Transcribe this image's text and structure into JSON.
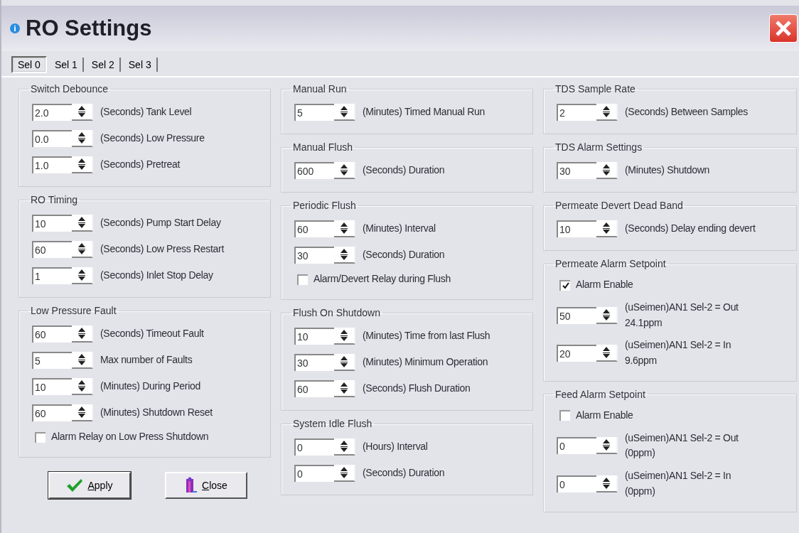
{
  "window": {
    "title": "RO Settings"
  },
  "tabs": [
    {
      "label": "Sel 0",
      "selected": true
    },
    {
      "label": "Sel 1",
      "selected": false
    },
    {
      "label": "Sel 2",
      "selected": false
    },
    {
      "label": "Sel 3",
      "selected": false
    }
  ],
  "columns": [
    {
      "groups": [
        {
          "title": "Switch Debounce",
          "items": [
            {
              "kind": "spin",
              "value": "2.0",
              "label": "(Seconds) Tank Level"
            },
            {
              "kind": "spin",
              "value": "0.0",
              "label": "(Seconds) Low Pressure"
            },
            {
              "kind": "spin",
              "value": "1.0",
              "label": "(Seconds) Pretreat"
            }
          ]
        },
        {
          "title": "RO Timing",
          "items": [
            {
              "kind": "spin",
              "value": "10",
              "label": "(Seconds) Pump Start Delay"
            },
            {
              "kind": "spin",
              "value": "60",
              "label": "(Seconds) Low Press Restart"
            },
            {
              "kind": "spin",
              "value": "1",
              "label": "(Seconds) Inlet Stop Delay"
            }
          ]
        },
        {
          "title": "Low Pressure Fault",
          "items": [
            {
              "kind": "spin",
              "value": "60",
              "label": "(Seconds) Timeout Fault"
            },
            {
              "kind": "spin",
              "value": "5",
              "label": "Max number of Faults"
            },
            {
              "kind": "spin",
              "value": "10",
              "label": "(Minutes) During Period"
            },
            {
              "kind": "spin",
              "value": "60",
              "label": "(Minutes) Shutdown Reset"
            },
            {
              "kind": "check",
              "checked": false,
              "caption": "Alarm Relay on Low Press Shutdown"
            }
          ]
        }
      ]
    },
    {
      "groups": [
        {
          "title": "Manual Run",
          "items": [
            {
              "kind": "spin",
              "value": "5",
              "label": "(Minutes) Timed Manual Run"
            }
          ]
        },
        {
          "title": "Manual Flush",
          "items": [
            {
              "kind": "spin",
              "value": "600",
              "label": "(Seconds) Duration"
            }
          ]
        },
        {
          "title": "Periodic Flush",
          "items": [
            {
              "kind": "spin",
              "value": "60",
              "label": "(Minutes) Interval"
            },
            {
              "kind": "spin",
              "value": "30",
              "label": "(Seconds) Duration"
            },
            {
              "kind": "check",
              "checked": false,
              "caption": "Alarm/Devert Relay during Flush"
            }
          ]
        },
        {
          "title": "Flush On Shutdown",
          "items": [
            {
              "kind": "spin",
              "value": "10",
              "label": "(Minutes) Time from last Flush"
            },
            {
              "kind": "spin",
              "value": "30",
              "label": "(Minutes) Minimum Operation"
            },
            {
              "kind": "spin",
              "value": "60",
              "label": "(Seconds) Flush Duration"
            }
          ]
        },
        {
          "title": "System Idle Flush",
          "items": [
            {
              "kind": "spin",
              "value": "0",
              "label": "(Hours) Interval"
            },
            {
              "kind": "spin",
              "value": "0",
              "label": "(Seconds) Duration"
            }
          ]
        }
      ]
    },
    {
      "groups": [
        {
          "title": "TDS Sample Rate",
          "items": [
            {
              "kind": "spin",
              "value": "2",
              "label": "(Seconds) Between Samples"
            }
          ]
        },
        {
          "title": "TDS Alarm Settings",
          "items": [
            {
              "kind": "spin",
              "value": "30",
              "label": "(Minutes) Shutdown"
            }
          ]
        },
        {
          "title": "Permeate Devert Dead Band",
          "items": [
            {
              "kind": "spin",
              "value": "10",
              "label": "(Seconds) Delay ending devert"
            }
          ]
        },
        {
          "title": "Permeate Alarm Setpoint",
          "items": [
            {
              "kind": "check",
              "checked": true,
              "caption": "Alarm Enable"
            },
            {
              "kind": "spin",
              "value": "50",
              "label": "(uSeimen)AN1 Sel-2 = Out\n24.1ppm"
            },
            {
              "kind": "spin",
              "value": "20",
              "label": "(uSeimen)AN1 Sel-2 = In\n9.6ppm"
            }
          ]
        },
        {
          "title": "Feed Alarm Setpoint",
          "items": [
            {
              "kind": "check",
              "checked": false,
              "caption": "Alarm Enable"
            },
            {
              "kind": "spin",
              "value": "0",
              "label": "(uSeimen)AN1 Sel-2 = Out\n(0ppm)"
            },
            {
              "kind": "spin",
              "value": "0",
              "label": "(uSeimen)AN1 Sel-2 = In\n(0ppm)"
            }
          ]
        }
      ]
    }
  ],
  "buttons": [
    {
      "kind": "apply",
      "label": "Apply"
    },
    {
      "kind": "close",
      "label": "Close"
    }
  ]
}
